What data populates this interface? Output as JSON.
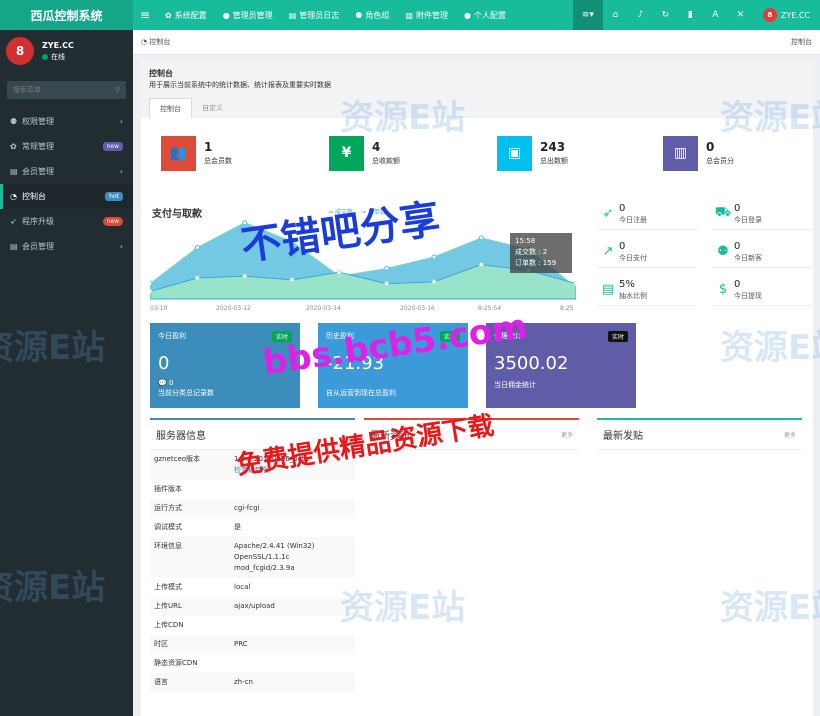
{
  "app": {
    "title": "西瓜控制系统",
    "user": "ZYE.CC"
  },
  "topnav": [
    {
      "icon": "gear-icon",
      "label": "系统配置"
    },
    {
      "icon": "user-icon",
      "label": "管理员管理"
    },
    {
      "icon": "list-icon",
      "label": "管理员日志"
    },
    {
      "icon": "group-icon",
      "label": "角色组"
    },
    {
      "icon": "file-icon",
      "label": "附件管理"
    },
    {
      "icon": "user-icon",
      "label": "个人配置"
    }
  ],
  "sidebar": {
    "user": {
      "name": "ZYE.CC",
      "status": "在线"
    },
    "search_placeholder": "搜索菜单",
    "items": [
      {
        "label": "权限管理",
        "icon": "users-icon",
        "badge": "",
        "chevron": "‹"
      },
      {
        "label": "常规管理",
        "icon": "cogs-icon",
        "badge": "new",
        "chevron": ""
      },
      {
        "label": "会员管理",
        "icon": "list-icon",
        "badge": "",
        "chevron": "‹"
      },
      {
        "label": "控制台",
        "icon": "dashboard-icon",
        "badge": "hot",
        "chevron": ""
      },
      {
        "label": "程序升级",
        "icon": "rocket-icon",
        "badge": "new",
        "chevron": ""
      },
      {
        "label": "会员管理",
        "icon": "list-icon",
        "badge": "",
        "chevron": "‹"
      }
    ]
  },
  "breadcrumb": {
    "left": "控制台",
    "right": "控制台"
  },
  "page": {
    "title": "控制台",
    "desc": "用于展示当前系统中的统计数据、统计报表及重要实时数据",
    "tabs": [
      "控制台",
      "自定义"
    ]
  },
  "stats": [
    {
      "value": "1",
      "label": "总会员数",
      "color": "#dd4b39",
      "icon": "👥"
    },
    {
      "value": "4",
      "label": "总收款额",
      "color": "#00a65a",
      "icon": "¥"
    },
    {
      "value": "243",
      "label": "总出数额",
      "color": "#00c0ef",
      "icon": "🛍"
    },
    {
      "value": "0",
      "label": "总会员分",
      "color": "#605ca8",
      "icon": "📖"
    }
  ],
  "chart_data": {
    "type": "area",
    "title": "支付与取款",
    "legend": [
      "成交数",
      "订单数"
    ],
    "x": [
      "03-10",
      "2020-03-12",
      "2020-03-14",
      "2020-03-16",
      "8:25:54",
      "8:25"
    ],
    "tooltip": [
      "15:58",
      "成交数 : 2",
      "订单数 : 159"
    ],
    "series": [
      {
        "name": "成交数",
        "values": [
          20,
          55,
          60,
          50,
          70,
          40,
          45,
          90,
          75,
          40
        ]
      },
      {
        "name": "订单数",
        "values": [
          40,
          135,
          200,
          150,
          60,
          80,
          110,
          160,
          130,
          30
        ]
      }
    ]
  },
  "right_stats": [
    {
      "value": "0",
      "label": "今日注册",
      "icon": "rocket-icon",
      "glyph": "➶"
    },
    {
      "value": "0",
      "label": "今日登录",
      "icon": "cart-icon",
      "glyph": "🛒"
    },
    {
      "value": "0",
      "label": "今日支付",
      "icon": "chart-icon",
      "glyph": "📈"
    },
    {
      "value": "0",
      "label": "今日新客",
      "icon": "users-icon",
      "glyph": "👥"
    },
    {
      "value": "5%",
      "label": "抽水比例",
      "icon": "table-icon",
      "glyph": "▤"
    },
    {
      "value": "0",
      "label": "今日提现",
      "icon": "dollar-icon",
      "glyph": "$"
    }
  ],
  "panels": [
    {
      "title": "今日盈利",
      "tag": "实时",
      "value": "0",
      "count": "0",
      "sub": "当前分类总记录数",
      "color": "#3c8dbc"
    },
    {
      "title": "历史盈利",
      "tag": "实时",
      "value": "-21.93",
      "count": "",
      "sub": "自从运营到现在总盈利",
      "color": "#3c9ad8"
    },
    {
      "title": "代理统计",
      "tag": "实时",
      "value": "3500.02",
      "count": "",
      "sub": "当日佣金统计",
      "color": "#605ca8"
    }
  ],
  "server_info": {
    "title": "服务器信息",
    "rows": [
      {
        "k": "gznetceo版本",
        "v": "1.0.0.20180906_beta",
        "extra": "检查最新版"
      },
      {
        "k": "插件版本",
        "v": "",
        "extra": ""
      },
      {
        "k": "运行方式",
        "v": "cgi-fcgi",
        "extra": ""
      },
      {
        "k": "调试模式",
        "v": "是",
        "extra": ""
      },
      {
        "k": "环境信息",
        "v": "Apache/2.4.41 (Win32) OpenSSL/1.1.1c mod_fcgid/2.3.9a",
        "extra": ""
      },
      {
        "k": "上传模式",
        "v": "local",
        "extra": ""
      },
      {
        "k": "上传URL",
        "v": "ajax/upload",
        "extra": ""
      },
      {
        "k": "上传CDN",
        "v": "",
        "extra": ""
      },
      {
        "k": "时区",
        "v": "PRC",
        "extra": ""
      },
      {
        "k": "静态资源CDN",
        "v": "",
        "extra": ""
      },
      {
        "k": "语言",
        "v": "zh-cn",
        "extra": ""
      }
    ]
  },
  "cards": [
    {
      "title": "最新资讯",
      "more": "更多"
    },
    {
      "title": "最新发贴",
      "more": "更多"
    }
  ],
  "watermarks": {
    "site": "资源E站",
    "domain": "ZYE.CC",
    "overlay1": "不错吧分享",
    "overlay2": "bbs.bcb5.com",
    "overlay3": "免费提供精品资源下载"
  }
}
